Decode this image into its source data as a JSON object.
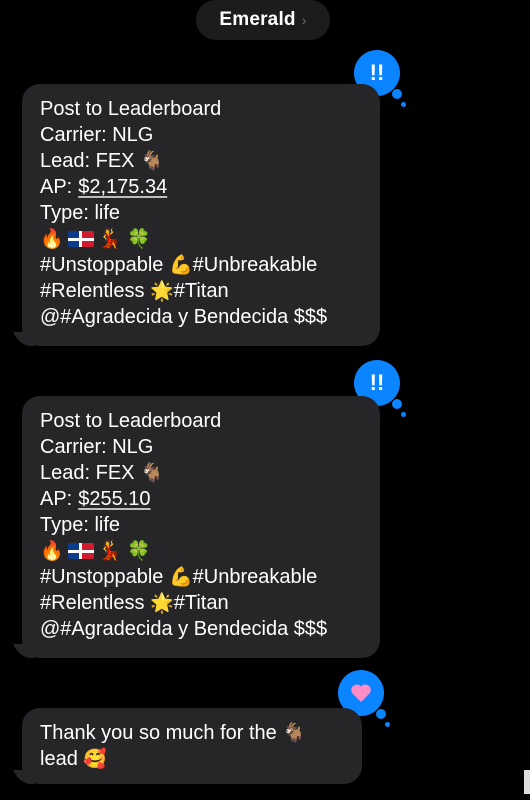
{
  "header": {
    "contact_name": "Emerald",
    "chevron": "›"
  },
  "messages": [
    {
      "tapback": "!!",
      "lines": [
        "Post to Leaderboard",
        "Carrier: NLG",
        "Lead: FEX",
        "AP:",
        "Type: life",
        "",
        "#Unstoppable",
        "#Relentless",
        "@#Agradecida y Bendecida $$$"
      ],
      "ap_value": "$2,175.34",
      "hashtag_b": "#Unbreakable",
      "hashtag_d": "#Titan",
      "emojis_row": [
        "🔥",
        "flag",
        "💃",
        "🍀"
      ],
      "lead_emoji": "🐐",
      "muscle_emoji": "💪",
      "star_emoji": "🌟"
    },
    {
      "tapback": "!!",
      "lines": [
        "Post to Leaderboard",
        "Carrier: NLG",
        "Lead: FEX",
        "AP:",
        "Type: life",
        "",
        "#Unstoppable",
        "#Relentless",
        "@#Agradecida y Bendecida $$$"
      ],
      "ap_value": "$255.10",
      "hashtag_b": "#Unbreakable",
      "hashtag_d": "#Titan",
      "emojis_row": [
        "🔥",
        "flag",
        "💃",
        "🍀"
      ],
      "lead_emoji": "🐐",
      "muscle_emoji": "💪",
      "star_emoji": "🌟"
    },
    {
      "tapback": "heart",
      "text_a": "Thank you so much for the",
      "text_b": "lead",
      "goat_emoji": "🐐",
      "smile_emoji": "🥰"
    }
  ],
  "colors": {
    "bubble": "#262629",
    "tapback_blue": "#0a84ff",
    "heart": "#ff7fb8"
  }
}
